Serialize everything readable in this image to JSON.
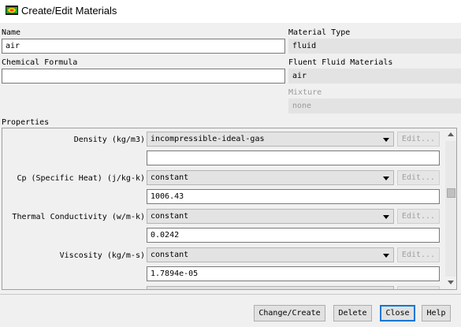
{
  "window": {
    "title": "Create/Edit Materials"
  },
  "name": {
    "label": "Name",
    "value": "air"
  },
  "chemical_formula": {
    "label": "Chemical Formula",
    "value": ""
  },
  "material_type": {
    "label": "Material Type",
    "value": "fluid"
  },
  "fluent_fluid_materials": {
    "label": "Fluent Fluid Materials",
    "value": "air"
  },
  "mixture": {
    "label": "Mixture",
    "value": "none"
  },
  "properties": {
    "label": "Properties",
    "rows": [
      {
        "label": "Density (kg/m3)",
        "method": "incompressible-ideal-gas",
        "edit": "Edit...",
        "value": ""
      },
      {
        "label": "Cp (Specific Heat) (j/kg-k)",
        "method": "constant",
        "edit": "Edit...",
        "value": "1006.43"
      },
      {
        "label": "Thermal Conductivity (w/m-k)",
        "method": "constant",
        "edit": "Edit...",
        "value": "0.0242"
      },
      {
        "label": "Viscosity (kg/m-s)",
        "method": "constant",
        "edit": "Edit...",
        "value": "1.7894e-05"
      }
    ]
  },
  "buttons": {
    "change_create": "Change/Create",
    "delete": "Delete",
    "close": "Close",
    "help": "Help"
  },
  "colors": {
    "accent": "#0078d7",
    "field_bg": "#ffffff",
    "readonly_bg": "#e3e3e3"
  }
}
